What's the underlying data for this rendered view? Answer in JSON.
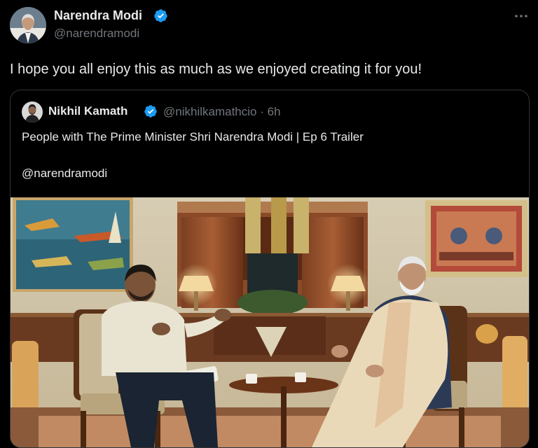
{
  "post": {
    "author_name": "Narendra Modi",
    "author_handle": "@narendramodi",
    "text": "I hope you all enjoy this as much as we enjoyed creating it for you!",
    "more_icon": "more-horizontal-icon",
    "verified_color": "#1d9bf0"
  },
  "quote": {
    "author_name": "Nikhil Kamath",
    "author_handle": "@nikhilkamathcio",
    "separator": "·",
    "time": "6h",
    "text": "People with The Prime Minister Shri Narendra Modi | Ep 6 Trailer",
    "mention": "@narendramodi",
    "media_description": "Interview scene: two men seated in armchairs facing each other in a warmly lit room with paintings, lamps and a small table with teacups"
  }
}
